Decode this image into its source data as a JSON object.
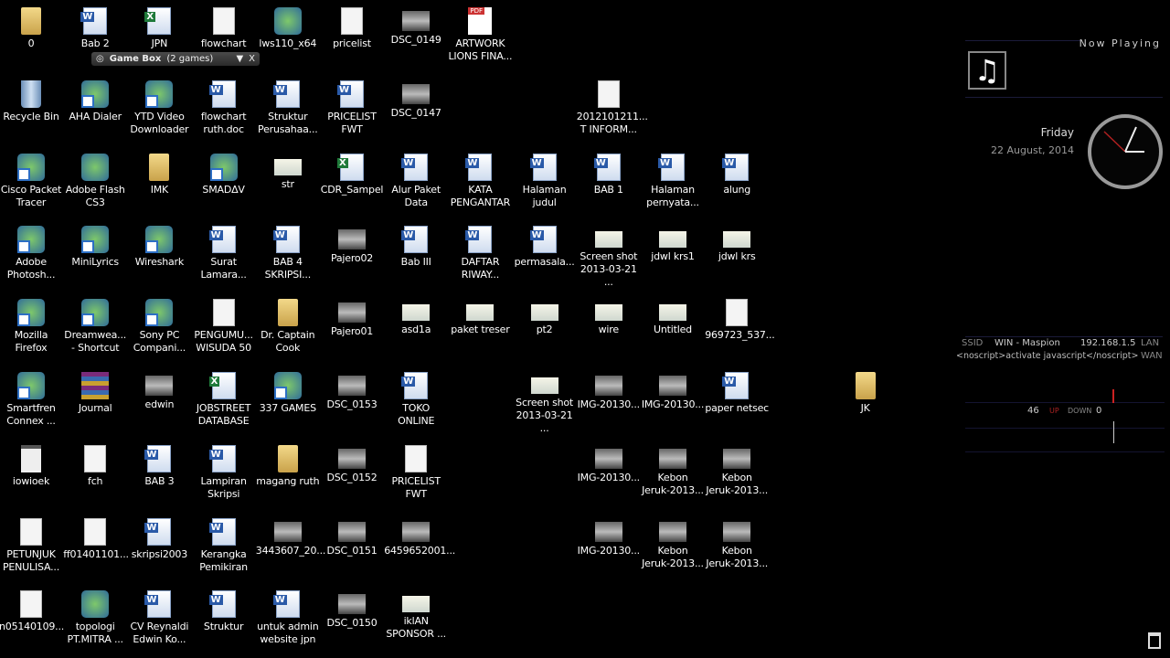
{
  "desktop": {
    "rows": [
      [
        {
          "label": "0",
          "type": "folder"
        },
        {
          "label": "Bab 2",
          "type": "word"
        },
        {
          "label": "JPN",
          "type": "excel"
        },
        {
          "label": "flowchart",
          "type": "doc"
        },
        {
          "label": "lws110_x64",
          "type": "app"
        },
        {
          "label": "pricelist",
          "type": "doc"
        },
        {
          "label": "DSC_0149",
          "type": "photo"
        },
        {
          "label": "ARTWORK\nLIONS FINA...",
          "type": "pdf"
        }
      ],
      [
        {
          "label": "Recycle Bin",
          "type": "recycle"
        },
        {
          "label": "AHA Dialer",
          "type": "app shortcut"
        },
        {
          "label": "YTD Video\nDownloader",
          "type": "app shortcut"
        },
        {
          "label": "flowchart\nruth.doc",
          "type": "word"
        },
        {
          "label": "Struktur\nPerusahaa...",
          "type": "word"
        },
        {
          "label": "PRICELIST\nFWT",
          "type": "word"
        },
        {
          "label": "DSC_0147",
          "type": "photo"
        },
        null,
        null,
        {
          "label": "2012101211...\nT INFORM...",
          "type": "doc"
        }
      ],
      [
        {
          "label": "Cisco Packet\nTracer",
          "type": "app shortcut"
        },
        {
          "label": "Adobe Flash\nCS3",
          "type": "app"
        },
        {
          "label": "IMK",
          "type": "folder"
        },
        {
          "label": "SMADΔV",
          "type": "app shortcut"
        },
        {
          "label": "str",
          "type": "image"
        },
        {
          "label": "CDR_Sampel",
          "type": "excel"
        },
        {
          "label": "Alur Paket\nData",
          "type": "word"
        },
        {
          "label": "KATA\nPENGANTAR",
          "type": "word"
        },
        {
          "label": "Halaman\njudul",
          "type": "word"
        },
        {
          "label": "BAB 1",
          "type": "word"
        },
        {
          "label": "Halaman\npernyata...",
          "type": "word"
        },
        {
          "label": "alung",
          "type": "word"
        }
      ],
      [
        {
          "label": "Adobe\nPhotosh...",
          "type": "app shortcut"
        },
        {
          "label": "MiniLyrics",
          "type": "app shortcut"
        },
        {
          "label": "Wireshark",
          "type": "app shortcut"
        },
        {
          "label": "Surat\nLamara...",
          "type": "word"
        },
        {
          "label": "BAB 4\nSKRIPSI...",
          "type": "word"
        },
        {
          "label": "Pajero02",
          "type": "photo"
        },
        {
          "label": "Bab III",
          "type": "word"
        },
        {
          "label": "DAFTAR\nRIWAY...",
          "type": "word"
        },
        {
          "label": "permasala...",
          "type": "word"
        },
        {
          "label": "Screen shot\n2013-03-21 ...",
          "type": "image"
        },
        {
          "label": "jdwl krs1",
          "type": "image"
        },
        {
          "label": "jdwl krs",
          "type": "image"
        }
      ],
      [
        {
          "label": "Mozilla\nFirefox",
          "type": "app shortcut"
        },
        {
          "label": "Dreamwea...\n- Shortcut",
          "type": "app shortcut"
        },
        {
          "label": "Sony PC\nCompani...",
          "type": "app shortcut"
        },
        {
          "label": "PENGUMU...\nWISUDA 50",
          "type": "doc"
        },
        {
          "label": "Dr. Captain\nCook",
          "type": "folder"
        },
        {
          "label": "Pajero01",
          "type": "photo"
        },
        {
          "label": "asd1a",
          "type": "image"
        },
        {
          "label": "paket treser",
          "type": "image"
        },
        {
          "label": "pt2",
          "type": "image"
        },
        {
          "label": "wire",
          "type": "image"
        },
        {
          "label": "Untitled",
          "type": "image"
        },
        {
          "label": "969723_537...",
          "type": "doc"
        }
      ],
      [
        {
          "label": "Smartfren\nConnex ...",
          "type": "app shortcut"
        },
        {
          "label": "Journal",
          "type": "rar"
        },
        {
          "label": "edwin",
          "type": "photo"
        },
        {
          "label": "JOBSTREET\nDATABASE",
          "type": "excel"
        },
        {
          "label": "337 GAMES",
          "type": "app shortcut"
        },
        {
          "label": "DSC_0153",
          "type": "photo"
        },
        {
          "label": "TOKO\nONLINE",
          "type": "word"
        },
        null,
        {
          "label": "Screen shot\n2013-03-21 ...",
          "type": "image"
        },
        {
          "label": "IMG-20130...",
          "type": "photo"
        },
        {
          "label": "IMG-20130...",
          "type": "photo"
        },
        {
          "label": "paper netsec",
          "type": "word"
        },
        null,
        {
          "label": "JK",
          "type": "folder"
        }
      ],
      [
        {
          "label": "iowioek",
          "type": "txt"
        },
        {
          "label": "fch",
          "type": "doc"
        },
        {
          "label": "BAB 3",
          "type": "word"
        },
        {
          "label": "Lampiran\nSkripsi",
          "type": "word"
        },
        {
          "label": "magang ruth",
          "type": "folder"
        },
        {
          "label": "DSC_0152",
          "type": "photo"
        },
        {
          "label": "PRICELIST\nFWT",
          "type": "doc"
        },
        null,
        null,
        {
          "label": "IMG-20130...",
          "type": "photo"
        },
        {
          "label": "Kebon\nJeruk-2013...",
          "type": "photo"
        },
        {
          "label": "Kebon\nJeruk-2013...",
          "type": "photo"
        }
      ],
      [
        {
          "label": "PETUNJUK\nPENULISA...",
          "type": "doc"
        },
        {
          "label": "ff01401101...",
          "type": "doc"
        },
        {
          "label": "skripsi2003",
          "type": "word"
        },
        {
          "label": "Kerangka\nPemikiran",
          "type": "word"
        },
        {
          "label": "3443607_20...",
          "type": "photo"
        },
        {
          "label": "DSC_0151",
          "type": "photo"
        },
        {
          "label": "6459652001...",
          "type": "photo"
        },
        null,
        null,
        {
          "label": "IMG-20130...",
          "type": "photo"
        },
        {
          "label": "Kebon\nJeruk-2013...",
          "type": "photo"
        },
        {
          "label": "Kebon\nJeruk-2013...",
          "type": "photo"
        }
      ],
      [
        {
          "label": "n05140109...",
          "type": "doc"
        },
        {
          "label": "topologi\nPT.MITRA ...",
          "type": "app"
        },
        {
          "label": "CV Reynaldi\nEdwin Ko...",
          "type": "word"
        },
        {
          "label": "Struktur",
          "type": "word"
        },
        {
          "label": "untuk admin\nwebsite jpn",
          "type": "word"
        },
        {
          "label": "DSC_0150",
          "type": "photo"
        },
        {
          "label": "iklAN\nSPONSOR ...",
          "type": "image"
        }
      ]
    ]
  },
  "gamebox": {
    "title": "Game Box",
    "count": "(2 games)",
    "dropdown": "▼",
    "close": "X"
  },
  "now_playing": {
    "title": "Now Playing",
    "icon": "music-note-icon"
  },
  "clock": {
    "day": "Friday",
    "date": "22 August, 2014"
  },
  "network": {
    "ssid_label": "SSID",
    "ssid": "WIN - Maspion",
    "ip": "192.168.1.5",
    "lan_label": "LAN",
    "wan_row": "<noscript>activate javascript</noscript>",
    "wan_label": "WAN",
    "up_value": "46",
    "up_label": "UP",
    "down_label": "DOWN",
    "down_value": "0"
  },
  "colors": {
    "background": "#000000",
    "up": "#cc2222"
  }
}
